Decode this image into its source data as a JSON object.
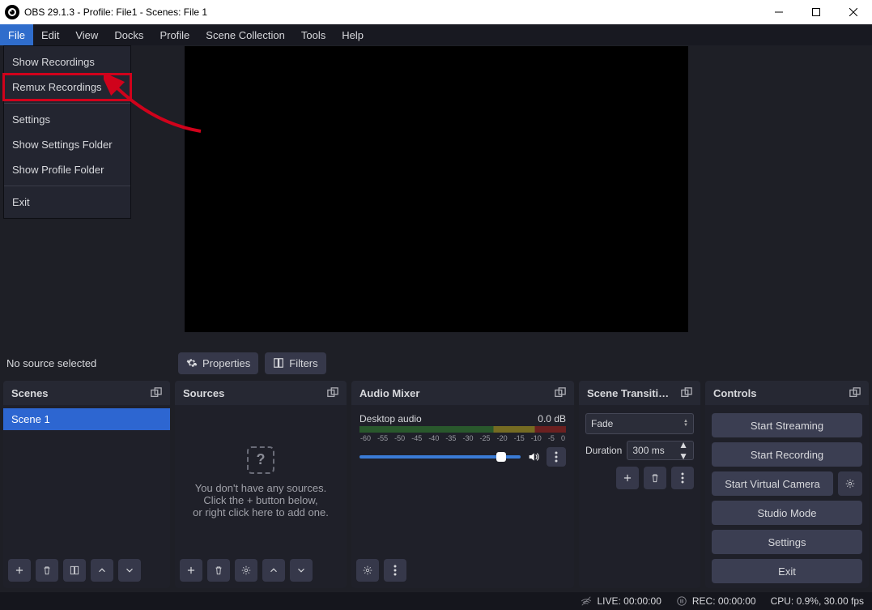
{
  "titlebar": {
    "text": "OBS 29.1.3 - Profile: File1 - Scenes: File 1"
  },
  "menu": {
    "items": [
      "File",
      "Edit",
      "View",
      "Docks",
      "Profile",
      "Scene Collection",
      "Tools",
      "Help"
    ],
    "active_index": 0
  },
  "dropdown": {
    "items": [
      {
        "label": "Show Recordings",
        "highlight": false
      },
      {
        "label": "Remux Recordings",
        "highlight": true
      },
      {
        "sep": true
      },
      {
        "label": "Settings",
        "highlight": false
      },
      {
        "label": "Show Settings Folder",
        "highlight": false
      },
      {
        "label": "Show Profile Folder",
        "highlight": false
      },
      {
        "sep": true
      },
      {
        "label": "Exit",
        "highlight": false
      }
    ]
  },
  "source_toolbar": {
    "no_source_text": "No source selected",
    "properties_label": "Properties",
    "filters_label": "Filters"
  },
  "panels": {
    "scenes": {
      "title": "Scenes",
      "item": "Scene 1"
    },
    "sources": {
      "title": "Sources",
      "empty_line1": "You don't have any sources.",
      "empty_line2": "Click the + button below,",
      "empty_line3": "or right click here to add one."
    },
    "audio": {
      "title": "Audio Mixer",
      "track_name": "Desktop audio",
      "track_db": "0.0 dB",
      "scale": [
        "-60",
        "-55",
        "-50",
        "-45",
        "-40",
        "-35",
        "-30",
        "-25",
        "-20",
        "-15",
        "-10",
        "-5",
        "0"
      ]
    },
    "transitions": {
      "title": "Scene Transiti…",
      "select_value": "Fade",
      "duration_label": "Duration",
      "duration_value": "300 ms"
    },
    "controls": {
      "title": "Controls",
      "start_streaming": "Start Streaming",
      "start_recording": "Start Recording",
      "start_virtual_camera": "Start Virtual Camera",
      "studio_mode": "Studio Mode",
      "settings": "Settings",
      "exit": "Exit"
    }
  },
  "statusbar": {
    "live": "LIVE: 00:00:00",
    "rec": "REC: 00:00:00",
    "cpu": "CPU: 0.9%, 30.00 fps"
  }
}
